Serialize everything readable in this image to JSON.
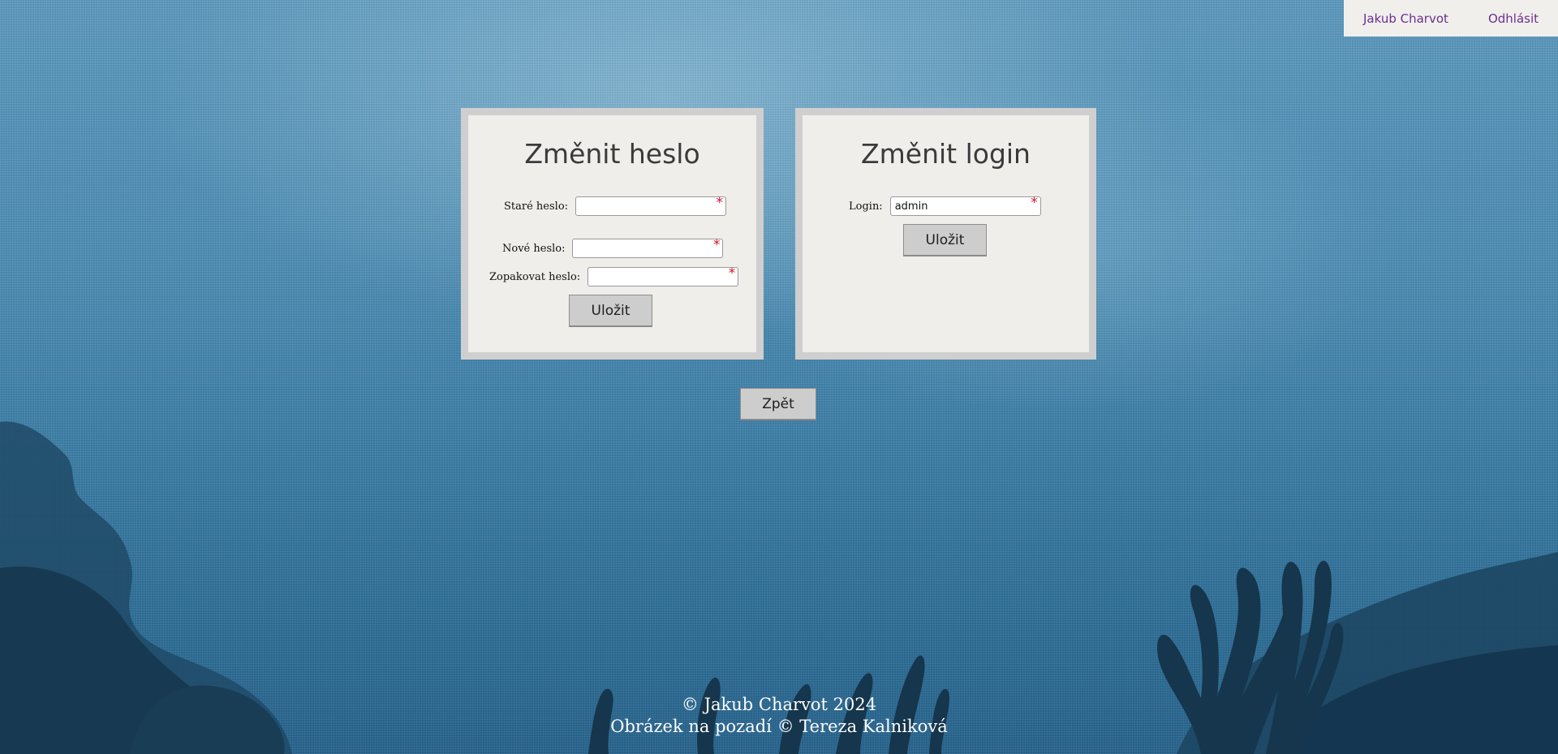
{
  "topbar": {
    "user_name": "Jakub Charvot",
    "logout_label": "Odhlásit",
    "link_color": "#6b2f8f"
  },
  "password_panel": {
    "title": "Změnit heslo",
    "fields": [
      {
        "label": "Staré heslo:",
        "value": "",
        "required_mark": "*"
      },
      {
        "label": "Nové heslo:",
        "value": "",
        "required_mark": "*"
      },
      {
        "label": "Zopakovat heslo:",
        "value": "",
        "required_mark": "*"
      }
    ],
    "save_label": "Uložit"
  },
  "login_panel": {
    "title": "Změnit login",
    "field": {
      "label": "Login:",
      "value": "admin",
      "required_mark": "*"
    },
    "save_label": "Uložit"
  },
  "back_label": "Zpět",
  "footer": {
    "line1": "© Jakub Charvot 2024",
    "line2": "Obrázek na pozadí © Tereza Kalniková"
  }
}
